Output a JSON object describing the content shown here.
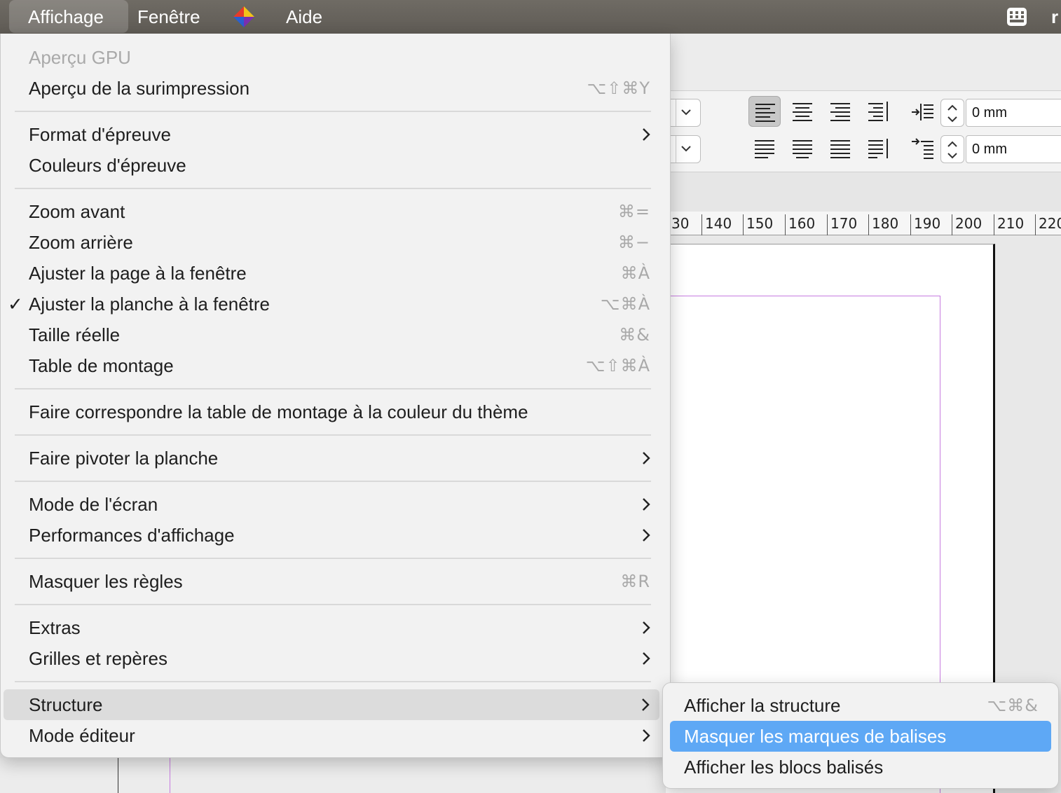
{
  "menubar": {
    "items": [
      "Affichage",
      "Fenêtre",
      "Aide"
    ],
    "logo_icon": "app-logo-icon",
    "right_icon": "input-menu-icon",
    "cut_text": "r"
  },
  "toolbar": {
    "indent_left_value": "0 mm",
    "indent_right_value": "0 mm"
  },
  "ruler": {
    "labels": [
      "30",
      "140",
      "150",
      "160",
      "170",
      "180",
      "190",
      "200",
      "210",
      "220"
    ]
  },
  "menu": {
    "items": [
      {
        "label": "Aperçu GPU",
        "shortcut": "",
        "disabled": true
      },
      {
        "label": "Aperçu de la surimpression",
        "shortcut": "⌥⇧⌘Y"
      },
      {
        "label": "Format d'épreuve",
        "submenu": true
      },
      {
        "label": "Couleurs d'épreuve"
      },
      {
        "label": "Zoom avant",
        "shortcut": "⌘="
      },
      {
        "label": "Zoom arrière",
        "shortcut": "⌘−"
      },
      {
        "label": "Ajuster la page à la fenêtre",
        "shortcut": "⌘À"
      },
      {
        "label": "Ajuster la planche à la fenêtre",
        "shortcut": "⌥⌘À",
        "checked": true
      },
      {
        "label": "Taille réelle",
        "shortcut": "⌘&"
      },
      {
        "label": "Table de montage",
        "shortcut": "⌥⇧⌘À"
      },
      {
        "label": "Faire correspondre la table de montage à la couleur du thème"
      },
      {
        "label": "Faire pivoter la planche",
        "submenu": true
      },
      {
        "label": "Mode de l'écran",
        "submenu": true
      },
      {
        "label": "Performances d'affichage",
        "submenu": true
      },
      {
        "label": "Masquer les règles",
        "shortcut": "⌘R"
      },
      {
        "label": "Extras",
        "submenu": true
      },
      {
        "label": "Grilles et repères",
        "submenu": true
      },
      {
        "label": "Structure",
        "submenu": true,
        "highlighted": true
      },
      {
        "label": "Mode éditeur",
        "submenu": true
      }
    ],
    "check_mark": "✓"
  },
  "submenu": {
    "items": [
      {
        "label": "Afficher la structure",
        "shortcut": "⌥⌘&"
      },
      {
        "label": "Masquer les marques de balises",
        "selected": true
      },
      {
        "label": "Afficher les blocs balisés"
      }
    ]
  },
  "colors": {
    "selection": "#5ea8f5",
    "menubar": "#66625c",
    "margin_guide": "#c77be0"
  }
}
